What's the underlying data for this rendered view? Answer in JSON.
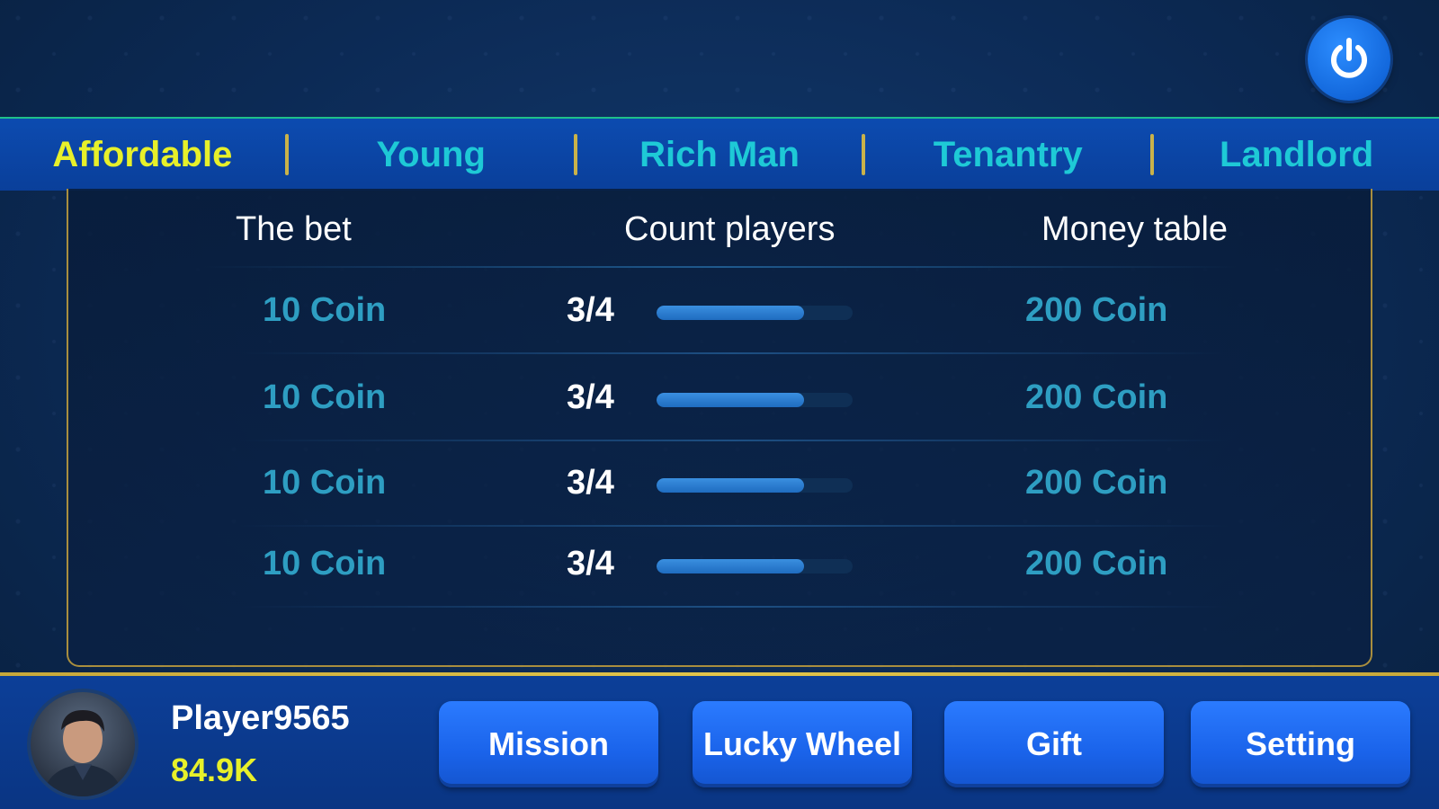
{
  "tabs": [
    {
      "label": "Affordable",
      "active": true
    },
    {
      "label": "Young",
      "active": false
    },
    {
      "label": "Rich Man",
      "active": false
    },
    {
      "label": "Tenantry",
      "active": false
    },
    {
      "label": "Landlord",
      "active": false
    }
  ],
  "table": {
    "headers": {
      "bet": "The bet",
      "count": "Count players",
      "money": "Money table"
    },
    "rows": [
      {
        "bet": "10 Coin",
        "count": "3/4",
        "fill": 0.75,
        "money": "200 Coin"
      },
      {
        "bet": "10 Coin",
        "count": "3/4",
        "fill": 0.75,
        "money": "200 Coin"
      },
      {
        "bet": "10 Coin",
        "count": "3/4",
        "fill": 0.75,
        "money": "200 Coin"
      },
      {
        "bet": "10 Coin",
        "count": "3/4",
        "fill": 0.75,
        "money": "200 Coin"
      }
    ]
  },
  "player": {
    "name": "Player9565",
    "coins": "84.9K"
  },
  "footer_buttons": {
    "mission": "Mission",
    "lucky_wheel": "Lucky Wheel",
    "gift": "Gift",
    "setting": "Setting"
  },
  "icons": {
    "power": "power-icon",
    "avatar": "player-avatar"
  },
  "colors": {
    "active_tab": "#e7f02a",
    "inactive_tab": "#1ec9d6",
    "button": "#1a63ea",
    "coins": "#e7f02a"
  }
}
